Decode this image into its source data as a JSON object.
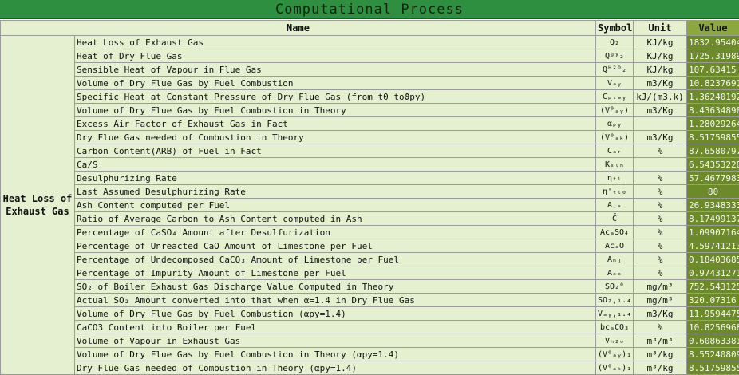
{
  "title": "Computational Process",
  "headers": {
    "name": "Name",
    "symbol": "Symbol",
    "unit": "Unit",
    "value": "Value"
  },
  "category": "Heat Loss of Exhaust Gas",
  "rows": [
    {
      "name": "Heat Loss of Exhaust Gas",
      "symbol": "Q₂",
      "unit": "KJ/kg",
      "value": "1832.95404"
    },
    {
      "name": "Heat of Dry Flue Gas",
      "symbol": "Qᵍʸ₂",
      "unit": "KJ/kg",
      "value": "1725.31989"
    },
    {
      "name": "Sensible Heat of Vapour in Flue Gas",
      "symbol": "Qᴴ²ᴼ₂",
      "unit": "KJ/kg",
      "value": "107.63415"
    },
    {
      "name": "Volume of Dry Flue Gas by Fuel Combustion",
      "symbol": "Vₐᵧ",
      "unit": "m3/Kg",
      "value": "10.8237691"
    },
    {
      "name": "Specific Heat at Constant Pressure of Dry Flue Gas (from t0 toϑpy)",
      "symbol": "Cₚ.ₐᵧ",
      "unit": "kJ/(m3.k)",
      "value": "1.36240192"
    },
    {
      "name": "Volume of Dry Flue Gas by Fuel Combustion in Theory",
      "symbol": "(V⁰ₐᵧ)",
      "unit": "m3/Kg",
      "value": "8.43634898"
    },
    {
      "name": "Excess Air Factor of Exhaust Gas in Fact",
      "symbol": "αₚᵧ",
      "unit": "",
      "value": "1.28029264"
    },
    {
      "name": "Dry Flue Gas needed of Combustion in Theory",
      "symbol": "(V⁰ₐₖ)",
      "unit": "m3/Kg",
      "value": "8.51759855"
    },
    {
      "name": "Carbon Content(ARB) of Fuel in Fact",
      "symbol": "Cₐᵣ",
      "unit": "%",
      "value": "87.6580797"
    },
    {
      "name": "Ca/S",
      "symbol": "Kₛₗₕ",
      "unit": "",
      "value": "6.54353228"
    },
    {
      "name": "Desulphurizing Rate",
      "symbol": "ηₜₗ",
      "unit": "%",
      "value": "57.4677983"
    },
    {
      "name": "Last Assumed Desulphurizing Rate",
      "symbol": "η'ₜₗ₀",
      "unit": "%",
      "value": "80"
    },
    {
      "name": "Ash Content computed per Fuel",
      "symbol": "Aⱼₛ",
      "unit": "%",
      "value": "26.9348333"
    },
    {
      "name": "Ratio of Average Carbon to Ash Content computed in Ash",
      "symbol": "C̄",
      "unit": "%",
      "value": "8.17499137"
    },
    {
      "name": "Percentage of CaSO₄ Amount after Desulfurization",
      "symbol": "AcₐSO₄",
      "unit": "%",
      "value": "1.09907164"
    },
    {
      "name": "Percentage of Unreacted CaO Amount of Limestone per Fuel",
      "symbol": "AcₐO",
      "unit": "%",
      "value": "4.59741213"
    },
    {
      "name": "Percentage of Undecomposed CaCO₃ Amount of Limestone per Fuel",
      "symbol": "Aₙⱼ",
      "unit": "%",
      "value": "0.18403685"
    },
    {
      "name": "Percentage of Impurity Amount of Limestone per Fuel",
      "symbol": "Aₓₓ",
      "unit": "%",
      "value": "0.97431271"
    },
    {
      "name": "SO₂ of Boiler Exhaust Gas Discharge Value Computed in Theory",
      "symbol": "SO₂⁰",
      "unit": "mg/m³",
      "value": "752.543125"
    },
    {
      "name": "Actual SO₂ Amount converted into that when α=1.4 in Dry Flue Gas",
      "symbol": "SO₂,₁.₄",
      "unit": "mg/m³",
      "value": "320.07316"
    },
    {
      "name": "Volume of Dry Flue Gas by Fuel Combustion (αpy=1.4)",
      "symbol": "Vₐᵧ,₁.₄",
      "unit": "m3/Kg",
      "value": "11.9594475"
    },
    {
      "name": "CaCO3 Content into Boiler per Fuel",
      "symbol": "bcₐCO₃",
      "unit": "%",
      "value": "10.8256968"
    },
    {
      "name": "Volume of Vapour in Exhaust Gas",
      "symbol": "Vₕ₂ₒ",
      "unit": "m³/m³",
      "value": "0.60863381"
    },
    {
      "name": "Volume of Dry Flue Gas by Fuel Combustion in Theory (αpy=1.4)",
      "symbol": "(V⁰ₐᵧ)₁.₄",
      "unit": "m³/kg",
      "value": "8.55240809"
    },
    {
      "name": "Dry Flue Gas needed of Combustion in Theory (αpy=1.4)",
      "symbol": "(V⁰ₐₖ)₁.₄",
      "unit": "m³/kg",
      "value": "8.51759855"
    }
  ]
}
